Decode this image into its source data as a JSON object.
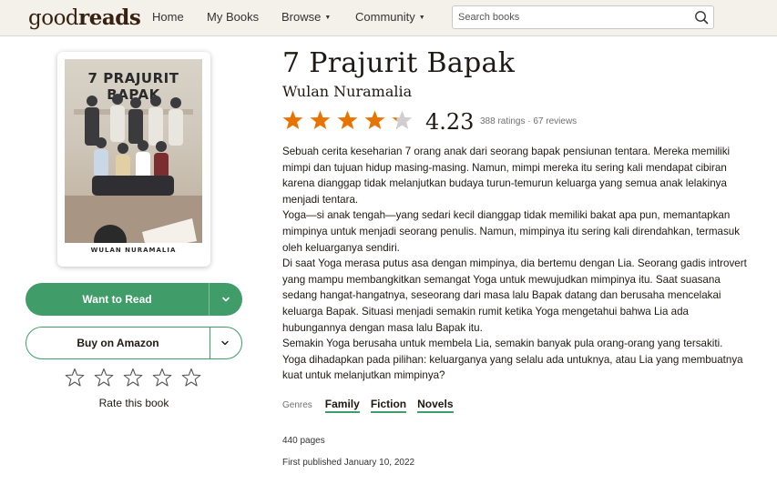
{
  "header": {
    "logo": {
      "light": "good",
      "bold": "reads"
    },
    "nav": [
      {
        "label": "Home",
        "has_caret": false
      },
      {
        "label": "My Books",
        "has_caret": false
      },
      {
        "label": "Browse",
        "has_caret": true
      },
      {
        "label": "Community",
        "has_caret": true
      }
    ],
    "search": {
      "placeholder": "Search books",
      "icon": "search-icon"
    }
  },
  "book": {
    "cover": {
      "title": "7 PRAJURIT BAPAK",
      "author": "WULAN NURAMALIA"
    },
    "title": "7 Prajurit Bapak",
    "author": "Wulan Nuramalia",
    "rating": 4.23,
    "rating_display": "4.23",
    "ratings_meta": "388 ratings · 67 reviews",
    "description": [
      "Sebuah cerita keseharian 7 orang anak dari seorang bapak pensiunan tentara. Mereka memiliki mimpi dan tujuan hidup masing-masing. Namun, mimpi mereka itu sering kali mendapat cibiran karena dianggap tidak melanjutkan budaya turun-temurun keluarga yang semua anak lelakinya menjadi tentara.",
      "Yoga—si anak tengah—yang sedari kecil dianggap tidak memiliki bakat apa pun, memantapkan mimpinya untuk menjadi seorang penulis. Namun, mimpinya itu sering kali direndahkan, termasuk oleh keluarganya sendiri.",
      "Di saat Yoga merasa putus asa dengan mimpinya, dia bertemu dengan Lia. Seorang gadis introvert yang mampu membangkitkan semangat Yoga untuk mewujudkan mimpinya itu. Saat suasana sedang hangat-hangatnya, seseorang dari masa lalu Bapak datang dan berusaha mencelakai keluarga Bapak. Situasi menjadi semakin rumit ketika Yoga mengetahui bahwa Lia ada hubungannya dengan masa lalu Bapak itu.",
      "Semakin Yoga berusaha untuk membela Lia, semakin banyak pula orang-orang yang tersakiti. Yoga dihadapkan pada pilihan: keluarganya yang selalu ada untuknya, atau Lia yang membuatnya kuat untuk melanjutkan mimpinya?"
    ],
    "genres_label": "Genres",
    "genres": [
      "Family",
      "Fiction",
      "Novels"
    ],
    "pages": "440 pages",
    "published": "First published January 10, 2022"
  },
  "actions": {
    "want_to_read": "Want to Read",
    "buy": "Buy on Amazon",
    "rate_label": "Rate this book",
    "rate_stars": 5
  },
  "colors": {
    "header_bg": "#f4f1ea",
    "logo": "#382110",
    "accent_green": "#409d69",
    "star_orange": "#e87400",
    "star_empty": "#d0cece"
  }
}
